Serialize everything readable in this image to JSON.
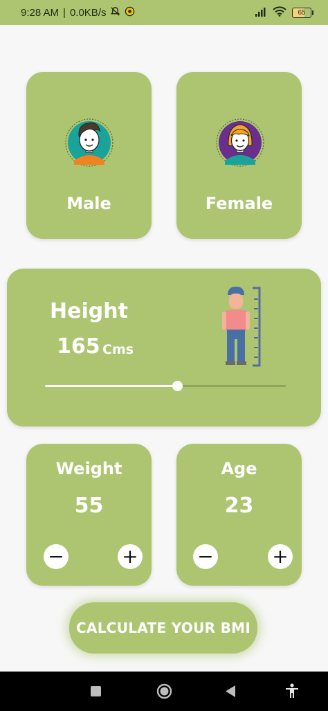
{
  "status": {
    "time": "9:28 AM",
    "sep": "|",
    "speed": "0.0KB/s",
    "battery": "65"
  },
  "gender": {
    "male_label": "Male",
    "female_label": "Female"
  },
  "height": {
    "title": "Height",
    "value": "165",
    "unit": "Cms",
    "slider_fraction": 0.55
  },
  "weight": {
    "title": "Weight",
    "value": "55",
    "minus": "−",
    "plus": "+"
  },
  "age": {
    "title": "Age",
    "value": "23",
    "minus": "−",
    "plus": "+"
  },
  "calculate_label": "CALCULATE YOUR BMI",
  "colors": {
    "card": "#adc571",
    "background": "#f7f7f7"
  }
}
